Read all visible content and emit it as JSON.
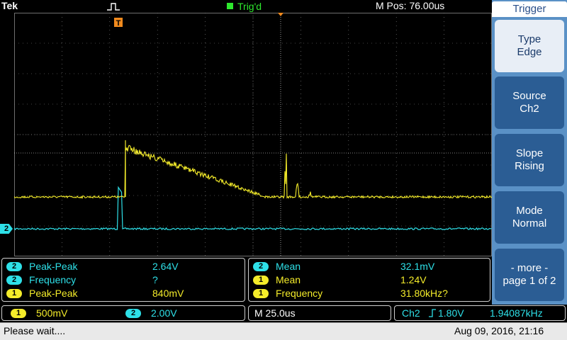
{
  "header": {
    "brand": "Tek",
    "trigger_state": "Trig'd",
    "horizontal_position": "M Pos: 76.00us"
  },
  "menu": {
    "title": "Trigger",
    "items": [
      {
        "line1": "Type",
        "line2": "Edge"
      },
      {
        "line1": "Source",
        "line2": "Ch2"
      },
      {
        "line1": "Slope",
        "line2": "Rising"
      },
      {
        "line1": "Mode",
        "line2": "Normal"
      },
      {
        "line1": "- more -",
        "line2": "page 1 of 2"
      }
    ]
  },
  "channel_marker": "2",
  "measurements_left": [
    {
      "channel": "2",
      "label": "Peak-Peak",
      "value": "2.64V"
    },
    {
      "channel": "2",
      "label": "Frequency",
      "value": "?"
    },
    {
      "channel": "1",
      "label": "Peak-Peak",
      "value": "840mV"
    }
  ],
  "measurements_right": [
    {
      "channel": "2",
      "label": "Mean",
      "value": "32.1mV"
    },
    {
      "channel": "1",
      "label": "Mean",
      "value": "1.24V"
    },
    {
      "channel": "1",
      "label": "Frequency",
      "value": "31.80kHz?"
    }
  ],
  "scales": {
    "ch1_badge": "1",
    "ch1_scale": "500mV",
    "ch2_badge": "2",
    "ch2_scale": "2.00V",
    "timebase": "M 25.0us",
    "trigger_source": "Ch2",
    "trigger_level": "1.80V",
    "trigger_freq": "1.94087kHz"
  },
  "status": {
    "message": "Please wait....",
    "datetime": "Aug 09, 2016, 21:16"
  },
  "colors": {
    "ch1": "#f4ec2a",
    "ch2": "#2ee0e8",
    "grid": "#8a8a8a",
    "trigger": "#f08a1e"
  }
}
